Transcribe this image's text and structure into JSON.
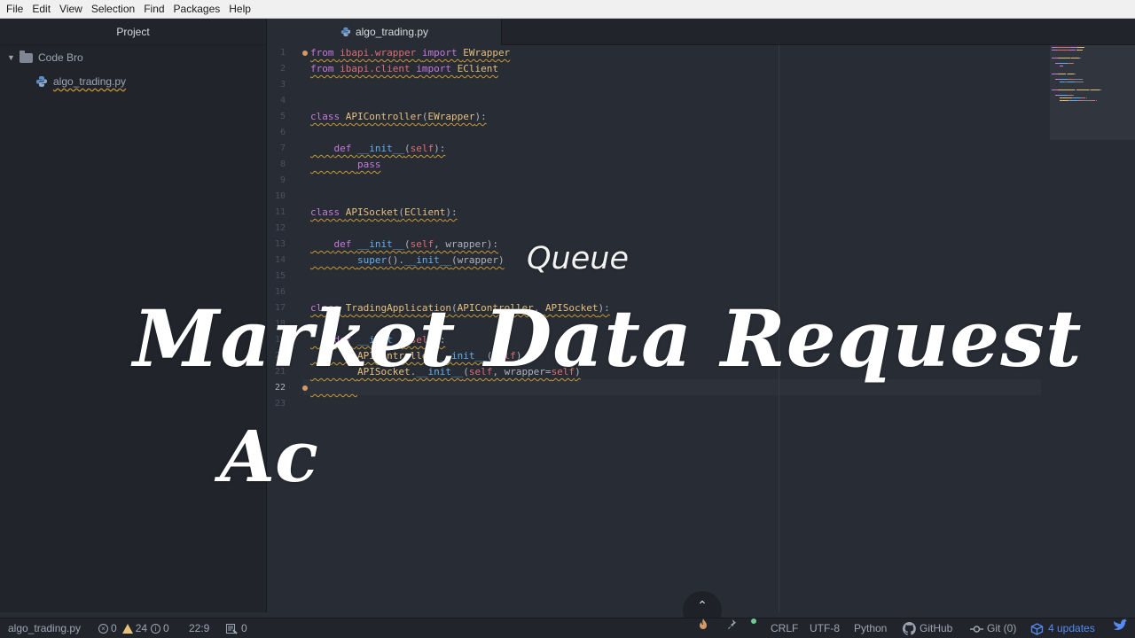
{
  "menu": [
    "File",
    "Edit",
    "View",
    "Selection",
    "Find",
    "Packages",
    "Help"
  ],
  "sidebar": {
    "title": "Project",
    "root": "Code Bro",
    "file": "algo_trading.py"
  },
  "tab": {
    "label": "algo_trading.py"
  },
  "editor": {
    "line_numbers": [
      "1",
      "2",
      "3",
      "4",
      "5",
      "6",
      "7",
      "8",
      "9",
      "10",
      "11",
      "12",
      "13",
      "14",
      "15",
      "16",
      "17",
      "18",
      "19",
      "20",
      "21",
      "22",
      "23"
    ],
    "lines": [
      [
        [
          "kw",
          "from "
        ],
        [
          "mod",
          "ibapi.wrapper "
        ],
        [
          "kw",
          "import "
        ],
        [
          "cls",
          "EWrapper"
        ]
      ],
      [
        [
          "kw",
          "from "
        ],
        [
          "mod",
          "ibapi.client "
        ],
        [
          "kw",
          "import "
        ],
        [
          "cls",
          "EClient"
        ]
      ],
      [],
      [],
      [
        [
          "kw",
          "class "
        ],
        [
          "cls",
          "APIController"
        ],
        [
          "plain",
          "("
        ],
        [
          "cls",
          "EWrapper"
        ],
        [
          "plain",
          "):"
        ]
      ],
      [],
      [
        [
          "plain",
          "    "
        ],
        [
          "kw",
          "def "
        ],
        [
          "fn",
          "__init__"
        ],
        [
          "plain",
          "("
        ],
        [
          "mod",
          "self"
        ],
        [
          "plain",
          "):"
        ]
      ],
      [
        [
          "plain",
          "        "
        ],
        [
          "kw",
          "pass"
        ]
      ],
      [],
      [],
      [
        [
          "kw",
          "class "
        ],
        [
          "cls",
          "APISocket"
        ],
        [
          "plain",
          "("
        ],
        [
          "cls",
          "EClient"
        ],
        [
          "plain",
          "):"
        ]
      ],
      [],
      [
        [
          "plain",
          "    "
        ],
        [
          "kw",
          "def "
        ],
        [
          "fn",
          "__init__"
        ],
        [
          "plain",
          "("
        ],
        [
          "mod",
          "self"
        ],
        [
          "plain",
          ", wrapper):"
        ]
      ],
      [
        [
          "plain",
          "        "
        ],
        [
          "fn",
          "super"
        ],
        [
          "plain",
          "()."
        ],
        [
          "fn",
          "__init__"
        ],
        [
          "plain",
          "(wrapper)"
        ]
      ],
      [],
      [],
      [
        [
          "kw",
          "class "
        ],
        [
          "cls",
          "TradingApplication"
        ],
        [
          "plain",
          "("
        ],
        [
          "cls",
          "APIController"
        ],
        [
          "plain",
          ", "
        ],
        [
          "cls",
          "APISocket"
        ],
        [
          "plain",
          "):"
        ]
      ],
      [],
      [
        [
          "plain",
          "    "
        ],
        [
          "kw",
          "def "
        ],
        [
          "fn",
          "__init__"
        ],
        [
          "plain",
          "("
        ],
        [
          "mod",
          "self"
        ],
        [
          "plain",
          "):"
        ]
      ],
      [
        [
          "plain",
          "        "
        ],
        [
          "cls",
          "APIController"
        ],
        [
          "plain",
          "."
        ],
        [
          "fn",
          "__init__"
        ],
        [
          "plain",
          "("
        ],
        [
          "mod",
          "self"
        ],
        [
          "plain",
          ")"
        ]
      ],
      [
        [
          "plain",
          "        "
        ],
        [
          "cls",
          "APISocket"
        ],
        [
          "plain",
          "."
        ],
        [
          "fn",
          "__init__"
        ],
        [
          "plain",
          "("
        ],
        [
          "mod",
          "self"
        ],
        [
          "plain",
          ", wrapper="
        ],
        [
          "mod",
          "self"
        ],
        [
          "plain",
          ")"
        ]
      ],
      [
        [
          "plain",
          "        "
        ]
      ],
      []
    ]
  },
  "overlay": {
    "main": "Market Data Request",
    "sub": "Ac",
    "queue": "Queue"
  },
  "scroll_button": "⌃",
  "status": {
    "file": "algo_trading.py",
    "errors": "0",
    "warnings": "24",
    "infos": "0",
    "cursor": "22:9",
    "selection_count": "0",
    "line_ending": "CRLF",
    "encoding": "UTF-8",
    "grammar": "Python",
    "github": "GitHub",
    "git": "Git (0)",
    "updates": "4 updates"
  },
  "colors": {
    "background": "#282c34",
    "panel": "#21252b",
    "keyword": "#c678dd",
    "module": "#e06c75",
    "class": "#e5c07b",
    "function": "#61afef",
    "accent": "#568af2",
    "warning": "#e5c07b"
  }
}
